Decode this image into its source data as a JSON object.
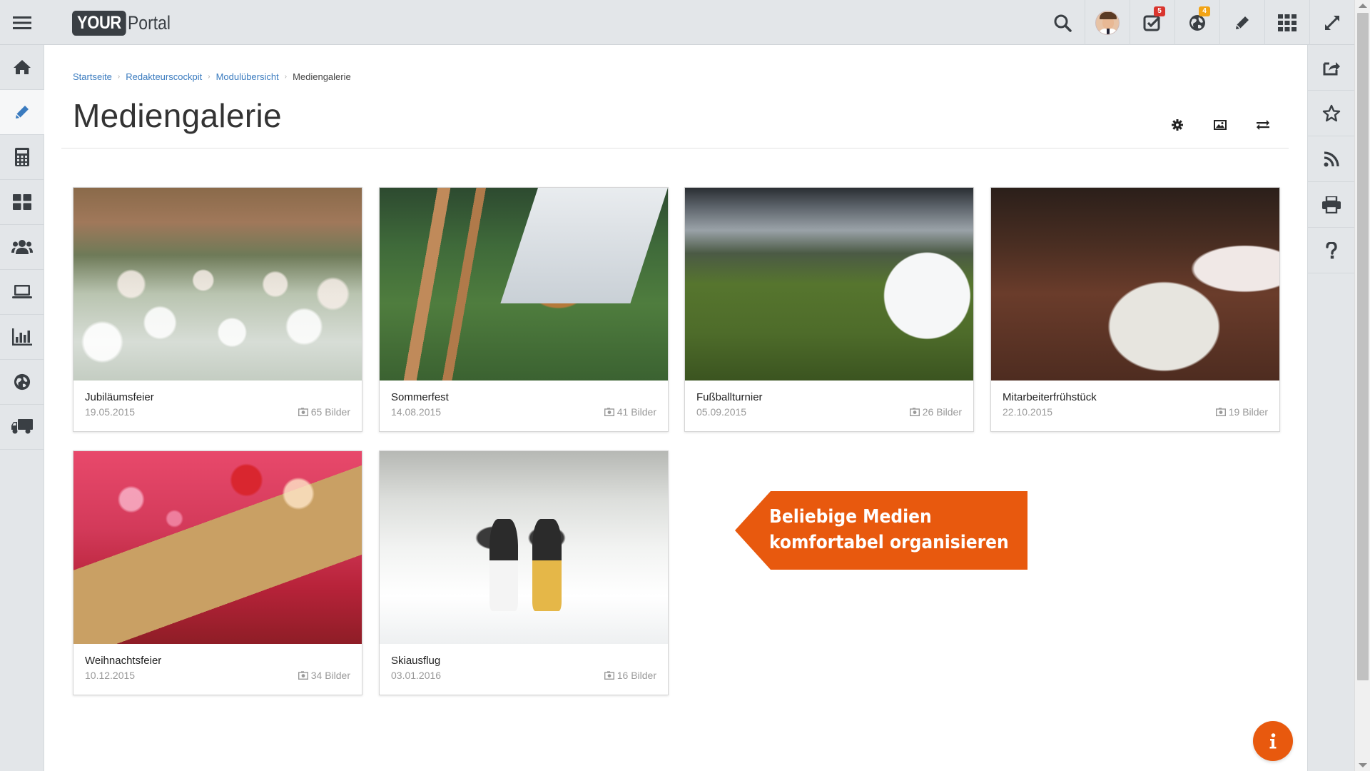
{
  "header": {
    "logo_your": "YOUR",
    "logo_portal": "Portal",
    "badges": {
      "tasks": "5",
      "globe": "4"
    }
  },
  "breadcrumb": [
    {
      "label": "Startseite"
    },
    {
      "label": "Redakteurscockpit"
    },
    {
      "label": "Modulübersicht"
    },
    {
      "label": "Mediengalerie"
    }
  ],
  "page": {
    "title": "Mediengalerie"
  },
  "gallery": [
    {
      "name": "Jubiläumsfeier",
      "date": "19.05.2015",
      "count": "65 Bilder"
    },
    {
      "name": "Sommerfest",
      "date": "14.08.2015",
      "count": "41 Bilder"
    },
    {
      "name": "Fußballturnier",
      "date": "05.09.2015",
      "count": "26 Bilder"
    },
    {
      "name": "Mitarbeiterfrühstück",
      "date": "22.10.2015",
      "count": "19 Bilder"
    },
    {
      "name": "Weihnachtsfeier",
      "date": "10.12.2015",
      "count": "34 Bilder"
    },
    {
      "name": "Skiausflug",
      "date": "03.01.2016",
      "count": "16 Bilder"
    }
  ],
  "promo": {
    "line1": "Beliebige Medien",
    "line2": "komfortabel organisieren"
  },
  "colors": {
    "accent": "#e8590e",
    "link": "#3a7bbf",
    "sidebar_bg": "#e3e6e9"
  },
  "icons": {
    "left_sidebar": [
      "home-icon",
      "pencil-icon",
      "calculator-icon",
      "dashboard-icon",
      "users-icon",
      "laptop-icon",
      "bar-chart-icon",
      "globe-icon",
      "truck-icon"
    ],
    "right_sidebar": [
      "share-icon",
      "star-icon",
      "rss-icon",
      "print-icon",
      "question-icon"
    ],
    "top_bar": [
      "menu-icon",
      "search-icon",
      "avatar",
      "tasks-icon",
      "globe-icon",
      "pencil-icon",
      "apps-grid-icon",
      "expand-icon"
    ],
    "title_tools": [
      "gear-icon",
      "image-icon",
      "transfer-icon"
    ]
  }
}
